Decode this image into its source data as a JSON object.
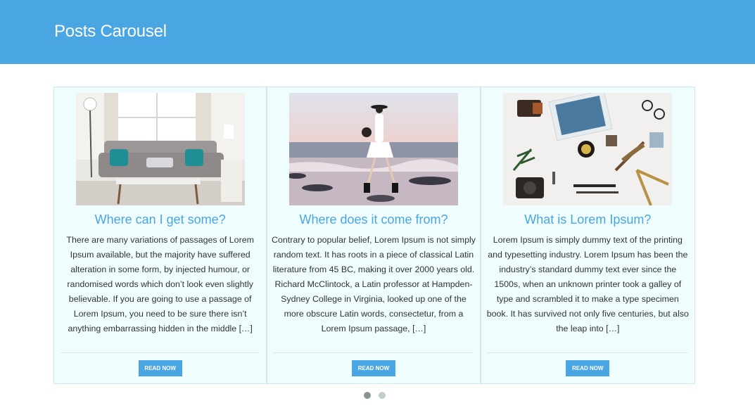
{
  "header": {
    "title": "Posts Carousel"
  },
  "posts": [
    {
      "title": "Where can I get some?",
      "excerpt": "There are many variations of passages of Lorem Ipsum available, but the majority have suffered alteration in some form, by injected humour, or randomised words which don’t look even slightly believable. If you are going to use a passage of Lorem Ipsum, you need to be sure there isn’t anything embarrassing hidden in the middle […]",
      "button": "Read Now",
      "image": "living-room-sofa-photo"
    },
    {
      "title": "Where does it come from?",
      "excerpt": "Contrary to popular belief, Lorem Ipsum is not simply random text. It has roots in a piece of classical Latin literature from 45 BC, making it over 2000 years old. Richard McClintock, a Latin professor at Hampden-Sydney College in Virginia, looked up one of the more obscure Latin words, consectetur, from a Lorem Ipsum passage, […]",
      "button": "Read Now",
      "image": "woman-walking-beach-photo"
    },
    {
      "title": "What is Lorem Ipsum?",
      "excerpt": "Lorem Ipsum is simply dummy text of the printing and typesetting industry. Lorem Ipsum has been the industry’s standard dummy text ever since the 1500s, when an unknown printer took a galley of type and scrambled it to make a type specimen book. It has survived not only five centuries, but also the leap into […]",
      "button": "Read Now",
      "image": "flatlay-desk-objects-photo"
    }
  ],
  "pagination": {
    "pages": 2,
    "active": 1
  },
  "colors": {
    "accent": "#4aa6e2",
    "card_bg": "#effdfe",
    "dot_active": "#869791",
    "dot_inactive": "#c2cdd0"
  }
}
